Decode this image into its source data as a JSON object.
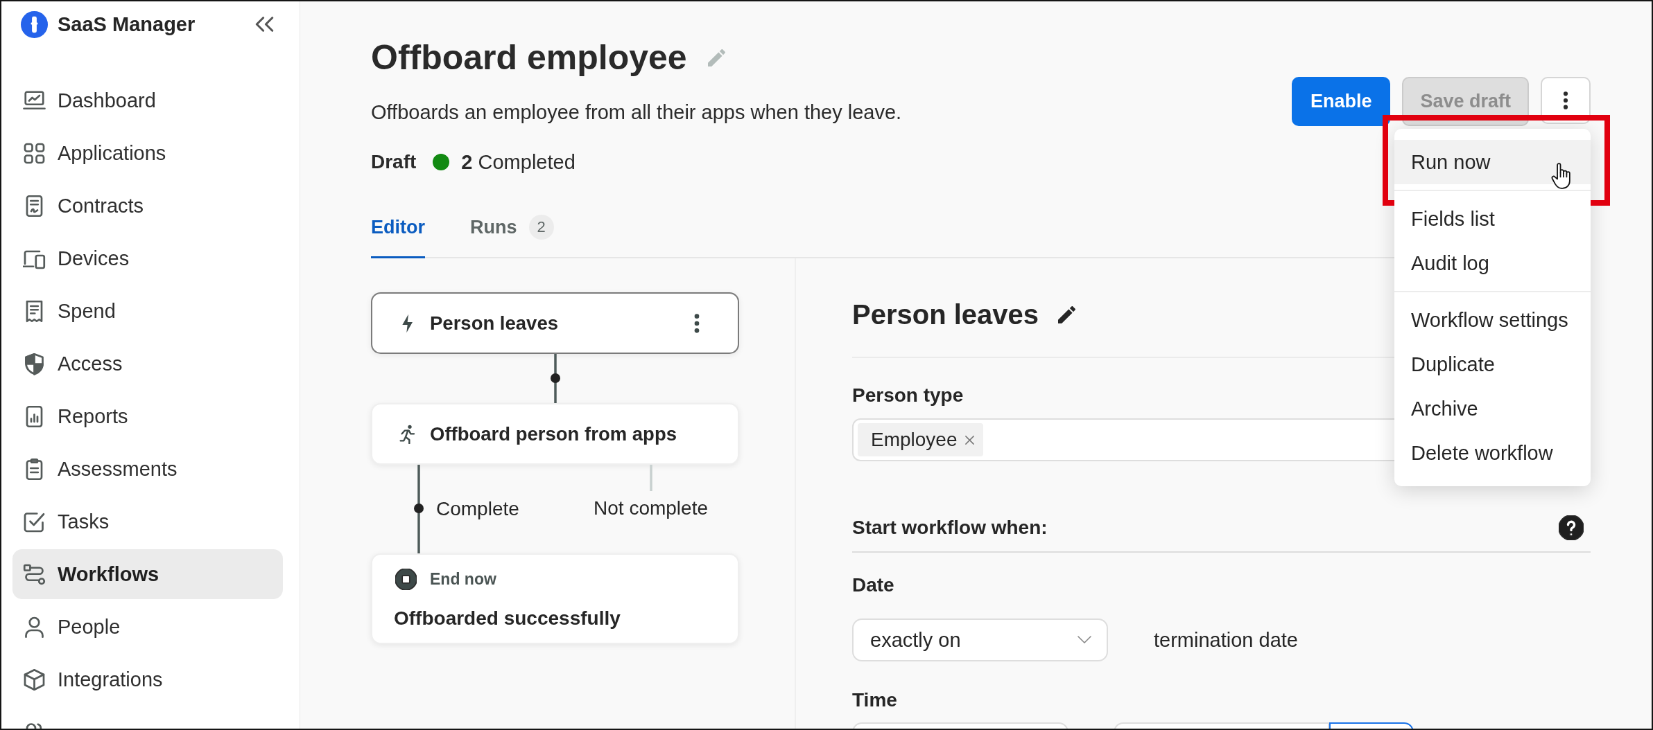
{
  "sidebar": {
    "app_name": "SaaS Manager",
    "items": [
      {
        "label": "Dashboard",
        "selected": false
      },
      {
        "label": "Applications",
        "selected": false
      },
      {
        "label": "Contracts",
        "selected": false
      },
      {
        "label": "Devices",
        "selected": false
      },
      {
        "label": "Spend",
        "selected": false
      },
      {
        "label": "Access",
        "selected": false
      },
      {
        "label": "Reports",
        "selected": false
      },
      {
        "label": "Assessments",
        "selected": false
      },
      {
        "label": "Tasks",
        "selected": false
      },
      {
        "label": "Workflows",
        "selected": true
      },
      {
        "label": "People",
        "selected": false
      },
      {
        "label": "Integrations",
        "selected": false
      },
      {
        "selected": false
      }
    ]
  },
  "header": {
    "title": "Offboard employee",
    "description": "Offboards an employee from all their apps when they leave.",
    "status": "Draft",
    "summary": "**2** Completed"
  },
  "actions": [
    {
      "kind": "primary",
      "label": "Enable",
      "disabled": false
    },
    {
      "kind": "secondary",
      "label": "Save draft",
      "disabled": true
    },
    {
      "kind": "more"
    }
  ],
  "menu": {
    "groups": [
      {
        "items": [
          {
            "label": "Run now",
            "hovered": true,
            "callout": true
          }
        ]
      },
      {
        "items": [
          {
            "label": "Fields list",
            "hovered": false,
            "callout": false
          },
          {
            "label": "Audit log",
            "hovered": false,
            "callout": false
          }
        ]
      },
      {
        "items": [
          {
            "label": "Workflow settings",
            "hovered": false,
            "callout": false
          },
          {
            "label": "Duplicate",
            "hovered": false,
            "callout": false
          },
          {
            "label": "Archive",
            "hovered": false,
            "callout": false
          },
          {
            "label": "Delete workflow",
            "hovered": false,
            "callout": false
          }
        ]
      }
    ]
  },
  "tabs": [
    {
      "label": "Editor",
      "selected": true
    },
    {
      "label": "Runs",
      "selected": false,
      "count": "2"
    }
  ],
  "flow": {
    "nodes": [
      {
        "kind": "trigger",
        "title": "Person leaves",
        "selected": true
      },
      {
        "kind": "action",
        "title": "Offboard person from apps",
        "selected": false
      },
      {
        "kind": "end",
        "label": "End now",
        "title": "Offboarded successfully",
        "selected": false
      }
    ],
    "branches": [
      {
        "label": "Complete",
        "active": true
      },
      {
        "label": "Not complete",
        "active": false
      }
    ]
  },
  "panel": {
    "title": "Person leaves",
    "person_type": {
      "label": "Person type",
      "chips": [
        "Employee"
      ]
    },
    "trigger": {
      "label": "Start workflow when:"
    },
    "date": {
      "label": "Date",
      "operator": "exactly on",
      "field": "termination date"
    },
    "time": {
      "label": "Time",
      "inputs": [
        {
          "focused": false
        },
        {
          "focused": false
        },
        {
          "focused": true
        }
      ]
    }
  }
}
